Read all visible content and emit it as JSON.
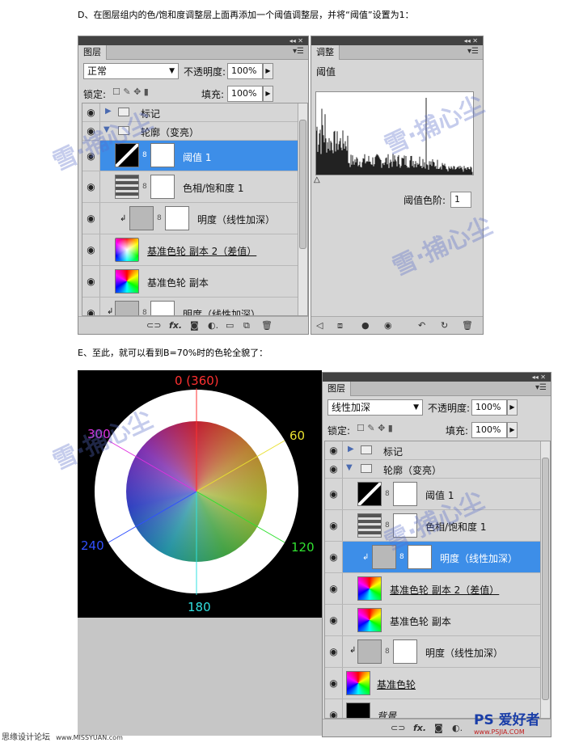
{
  "caption_d": "D、在图层组内的色/饱和度调整层上面再添加一个阈值调整层，并将“阈值”设置为1：",
  "caption_e": "E、至此，就可以看到B=70%时的色轮全貌了：",
  "titlebar_arrows": "◂◂ ✕",
  "panel1": {
    "tab": "图层",
    "blend_mode": "正常",
    "opacity_label": "不透明度:",
    "opacity_value": "100%",
    "lock_label": "锁定:",
    "fill_label": "填充:",
    "fill_value": "100%",
    "layers": [
      {
        "name": "标记",
        "kind": "group-collapsed"
      },
      {
        "name": "轮廓（变亮）",
        "kind": "group-expanded"
      },
      {
        "name": "阈值 1",
        "kind": "threshold",
        "selected": true
      },
      {
        "name": "色相/饱和度 1",
        "kind": "huesat"
      },
      {
        "name": "明度（线性加深）",
        "kind": "clipped-gray"
      },
      {
        "name": "基准色轮 副本 2（差值）",
        "kind": "wheel",
        "underline": true
      },
      {
        "name": "基准色轮 副本",
        "kind": "wheel"
      },
      {
        "name": "明度（线性加深）",
        "kind": "clipped-gray-bottom"
      }
    ]
  },
  "adjust_panel": {
    "tab": "调整",
    "title": "阈值",
    "level_label": "阈值色阶:",
    "level_value": "1"
  },
  "wheel": {
    "labels": [
      {
        "text": "0 (360)",
        "color": "#ff3030"
      },
      {
        "text": "60",
        "color": "#e8e030"
      },
      {
        "text": "120",
        "color": "#30e030"
      },
      {
        "text": "180",
        "color": "#30e0e0"
      },
      {
        "text": "240",
        "color": "#3050ff"
      },
      {
        "text": "300",
        "color": "#e030e0"
      }
    ]
  },
  "panel2": {
    "tab": "图层",
    "blend_mode": "线性加深",
    "opacity_label": "不透明度:",
    "opacity_value": "100%",
    "lock_label": "锁定:",
    "fill_label": "填充:",
    "fill_value": "100%",
    "layers": [
      {
        "name": "标记",
        "kind": "group-collapsed"
      },
      {
        "name": "轮廓（变亮）",
        "kind": "group-expanded"
      },
      {
        "name": "阈值 1",
        "kind": "threshold"
      },
      {
        "name": "色相/饱和度 1",
        "kind": "huesat"
      },
      {
        "name": "明度（线性加深）",
        "kind": "clipped-gray",
        "selected": true
      },
      {
        "name": "基准色轮 副本 2（差值）",
        "kind": "wheel",
        "underline": true
      },
      {
        "name": "基准色轮 副本",
        "kind": "wheel"
      },
      {
        "name": "明度（线性加深）",
        "kind": "gray"
      },
      {
        "name": "基准色轮",
        "kind": "wheel",
        "underline": true
      },
      {
        "name": "背景",
        "kind": "black"
      }
    ]
  },
  "watermark": "雪·捕心尘",
  "footer_left": "思缘设计论坛",
  "footer_left_url": "www.MISSYUAN.com",
  "logo": "PS 爱好者",
  "logo_url": "www.PSJIA.COM"
}
